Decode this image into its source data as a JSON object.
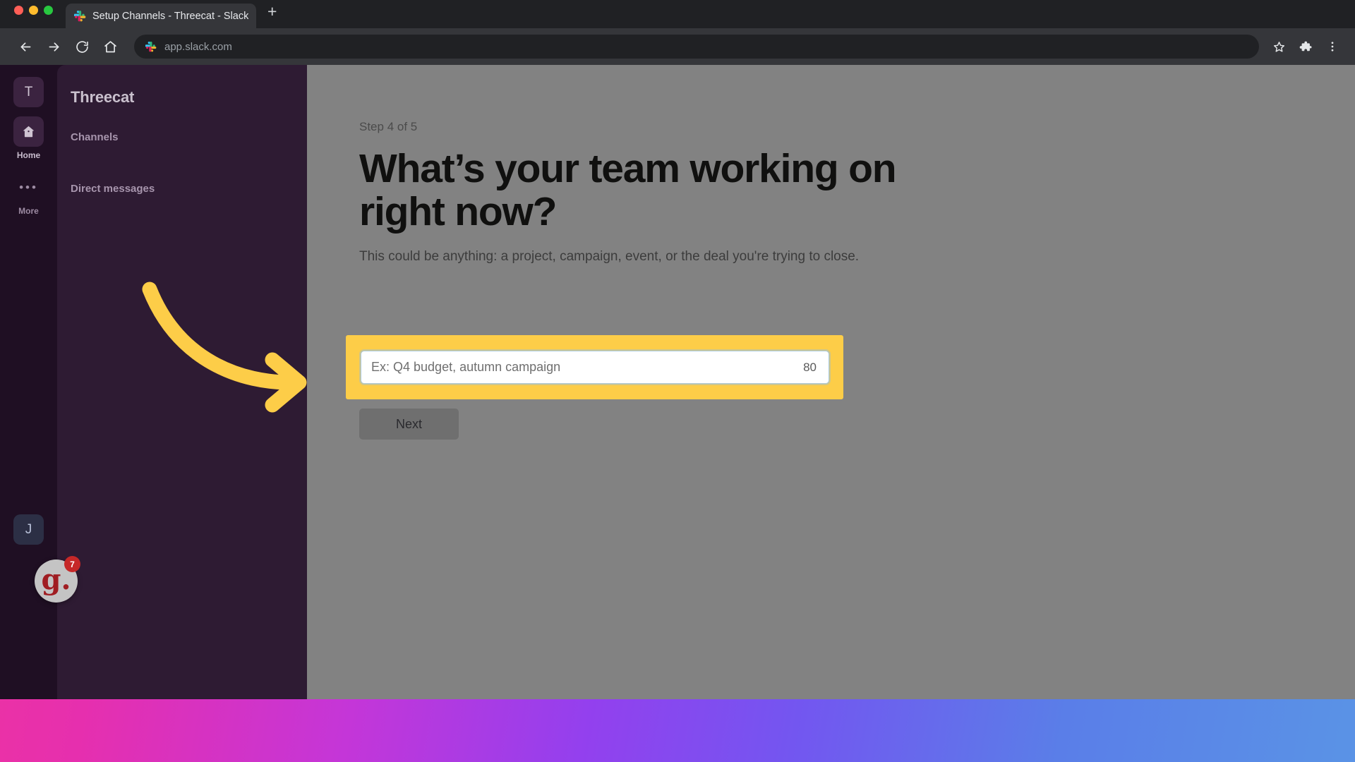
{
  "browser": {
    "tab": {
      "title": "Setup Channels - Threecat - Slack",
      "favicon": "slack-icon"
    },
    "new_tab_label": "+",
    "toolbar": {
      "back": "back-icon",
      "forward": "forward-icon",
      "reload": "reload-icon",
      "home": "home-icon",
      "url": "app.slack.com",
      "bookmark": "star-icon",
      "extensions": "puzzle-icon",
      "menu": "three-dot-menu-icon"
    }
  },
  "slack": {
    "rail": {
      "workspace_initial": "T",
      "items": [
        {
          "label": "Home",
          "icon": "home-icon"
        },
        {
          "label": "More",
          "icon": "ellipsis-icon"
        }
      ],
      "user_initial": "J"
    },
    "sidebar": {
      "workspace_name": "Threecat",
      "sections": [
        {
          "label": "Channels"
        },
        {
          "label": "Direct messages"
        }
      ]
    },
    "setup": {
      "step_label": "Step 4 of 5",
      "headline": "What’s your team working on right now?",
      "subtitle": "This could be anything: a project, campaign, event, or the deal you're trying to close.",
      "input": {
        "value": "",
        "placeholder": "Ex: Q4 budget, autumn campaign",
        "char_counter": "80"
      },
      "next_label": "Next"
    }
  },
  "annotation": {
    "arrow": "curved-arrow-right",
    "arrow_color": "#fdcd48",
    "highlight_color": "#fdcd48"
  },
  "recorder": {
    "logo_text": "g.",
    "notification_count": "7"
  }
}
